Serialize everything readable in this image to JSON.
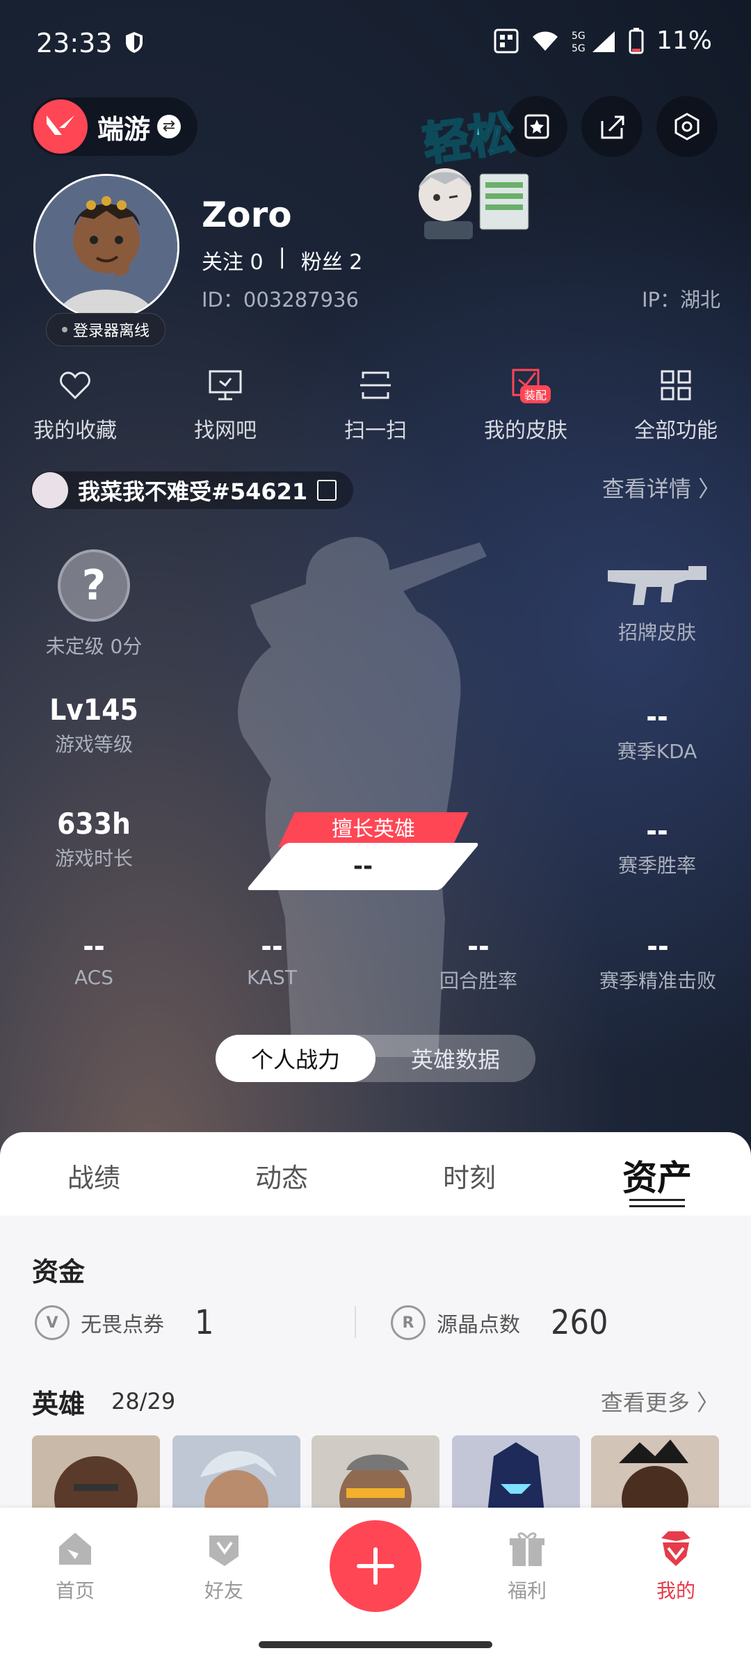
{
  "status": {
    "time": "23:33",
    "battery": "11%"
  },
  "header": {
    "game_name": "端游"
  },
  "sticker": {
    "text": "轻松"
  },
  "profile": {
    "username": "Zoro",
    "follow_label": "关注",
    "follow_count": "0",
    "fans_label": "粉丝",
    "fans_count": "2",
    "id_text": "ID：003287936",
    "ip_text": "IP：湖北",
    "offline": "登录器离线"
  },
  "quick": [
    {
      "label": "我的收藏",
      "icon": "heart-icon"
    },
    {
      "label": "找网吧",
      "icon": "monitor-icon"
    },
    {
      "label": "扫一扫",
      "icon": "scan-icon"
    },
    {
      "label": "我的皮肤",
      "icon": "skin-icon",
      "badge": "装配"
    },
    {
      "label": "全部功能",
      "icon": "grid-icon"
    }
  ],
  "player": {
    "tag": "我菜我不难受#54621",
    "view_detail": "查看详情 〉"
  },
  "stats": {
    "rank_label": "未定级 0分",
    "skin_label": "招牌皮肤",
    "level_value": "Lv145",
    "level_label": "游戏等级",
    "kda_value": "--",
    "kda_label": "赛季KDA",
    "hours_value": "633h",
    "hours_label": "游戏时长",
    "winrate_value": "--",
    "winrate_label": "赛季胜率",
    "expert_label": "擅长英雄",
    "expert_value": "--",
    "acs_value": "--",
    "acs_label": "ACS",
    "kast_value": "--",
    "kast_label": "KAST",
    "round_value": "--",
    "round_label": "回合胜率",
    "precise_value": "--",
    "precise_label": "赛季精准击败"
  },
  "segment": {
    "personal": "个人战力",
    "hero_data": "英雄数据"
  },
  "tabs": [
    "战绩",
    "动态",
    "时刻",
    "资产"
  ],
  "assets": {
    "funds_title": "资金",
    "vp_label": "无畏点券",
    "vp_value": "1",
    "rp_label": "源晶点数",
    "rp_value": "260",
    "heroes_title": "英雄",
    "heroes_owned": "28",
    "heroes_total": "29",
    "see_more": "查看更多 〉"
  },
  "nav": [
    "首页",
    "好友",
    "福利",
    "我的"
  ],
  "colors": {
    "accent": "#ff4655"
  }
}
